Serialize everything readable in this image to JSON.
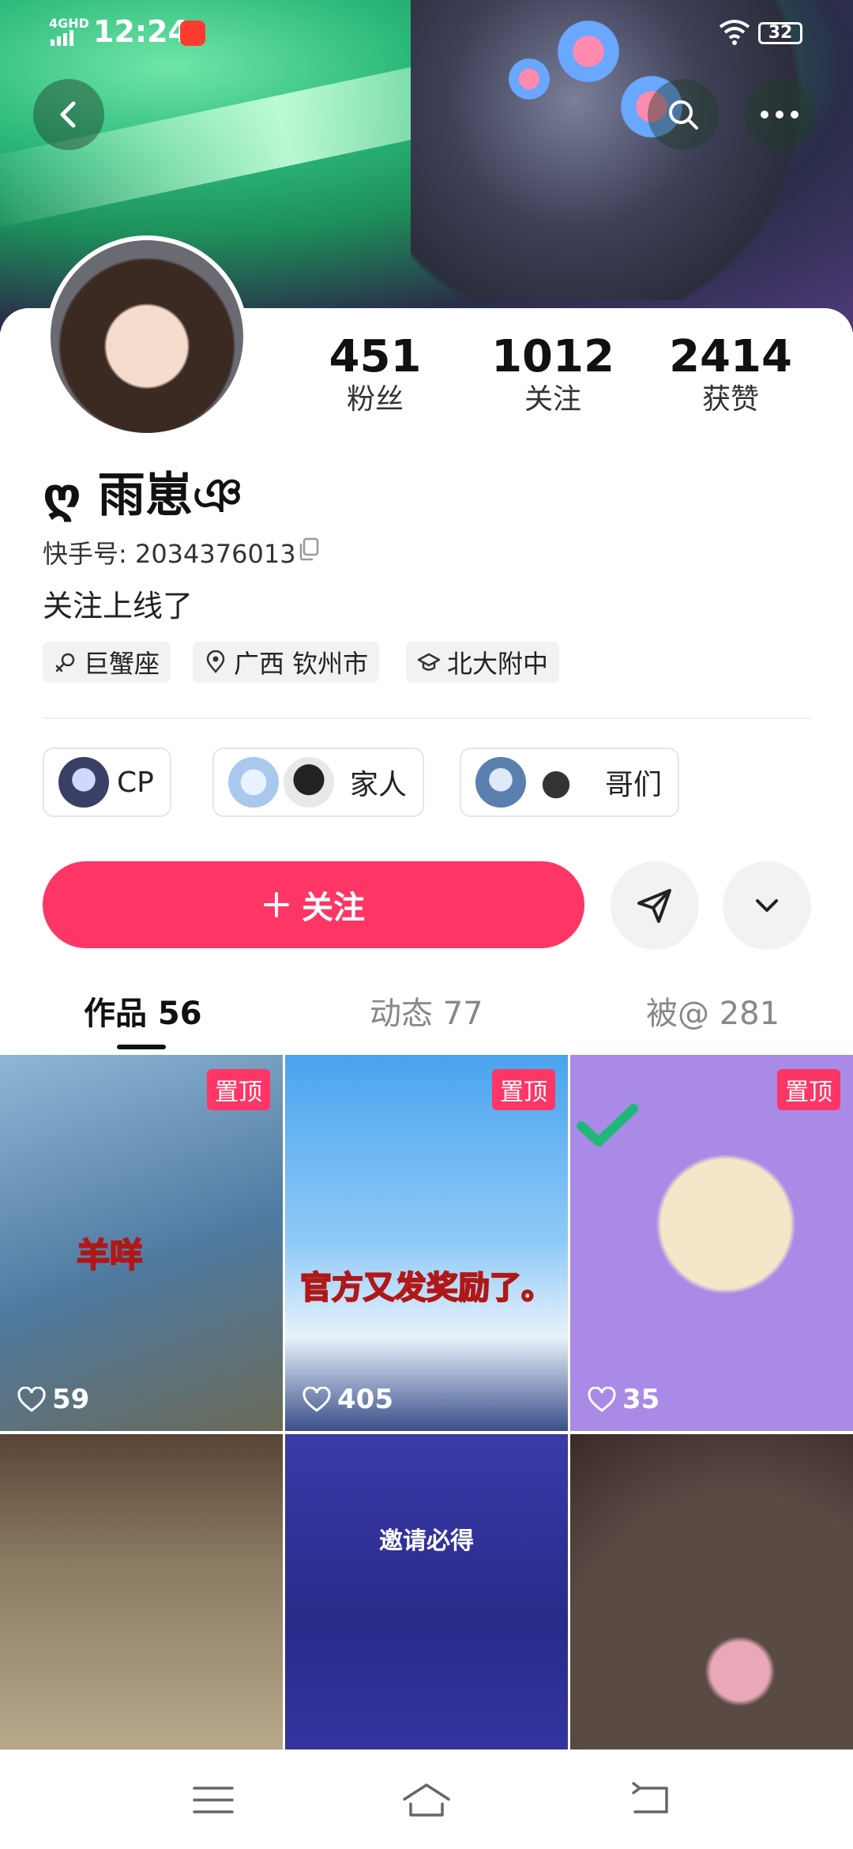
{
  "status_bar": {
    "network": "4GHD",
    "time": "12:24",
    "battery": "32"
  },
  "profile": {
    "stats": [
      {
        "value": "451",
        "label": "粉丝"
      },
      {
        "value": "1012",
        "label": "关注"
      },
      {
        "value": "2414",
        "label": "获赞"
      }
    ],
    "name": "ღ 雨崽ঞ",
    "kuaishou_id": "快手号: 2034376013",
    "bio": "关注上线了",
    "tags": [
      {
        "icon": "zodiac-icon",
        "label": "巨蟹座"
      },
      {
        "icon": "location-icon",
        "label": "广西 钦州市"
      },
      {
        "icon": "school-icon",
        "label": "北大附中"
      }
    ]
  },
  "groups": [
    {
      "label": "CP"
    },
    {
      "label": "家人"
    },
    {
      "label": "哥们"
    }
  ],
  "actions": {
    "follow_label": "关注",
    "follow_color": "#fe3666"
  },
  "tabs": [
    {
      "label": "作品 56",
      "active": true
    },
    {
      "label": "动态 77",
      "active": false
    },
    {
      "label": "被@ 281",
      "active": false
    }
  ],
  "videos": [
    {
      "pinned": "置顶",
      "likes": "59",
      "caption": "羊咩"
    },
    {
      "pinned": "置顶",
      "likes": "405",
      "caption": "官方又发奖励了。"
    },
    {
      "pinned": "置顶",
      "likes": "35",
      "caption": ""
    },
    {
      "pinned": "",
      "likes": "",
      "caption": ""
    },
    {
      "pinned": "",
      "likes": "",
      "caption": "邀请必得"
    },
    {
      "pinned": "",
      "likes": "",
      "caption": ""
    }
  ]
}
